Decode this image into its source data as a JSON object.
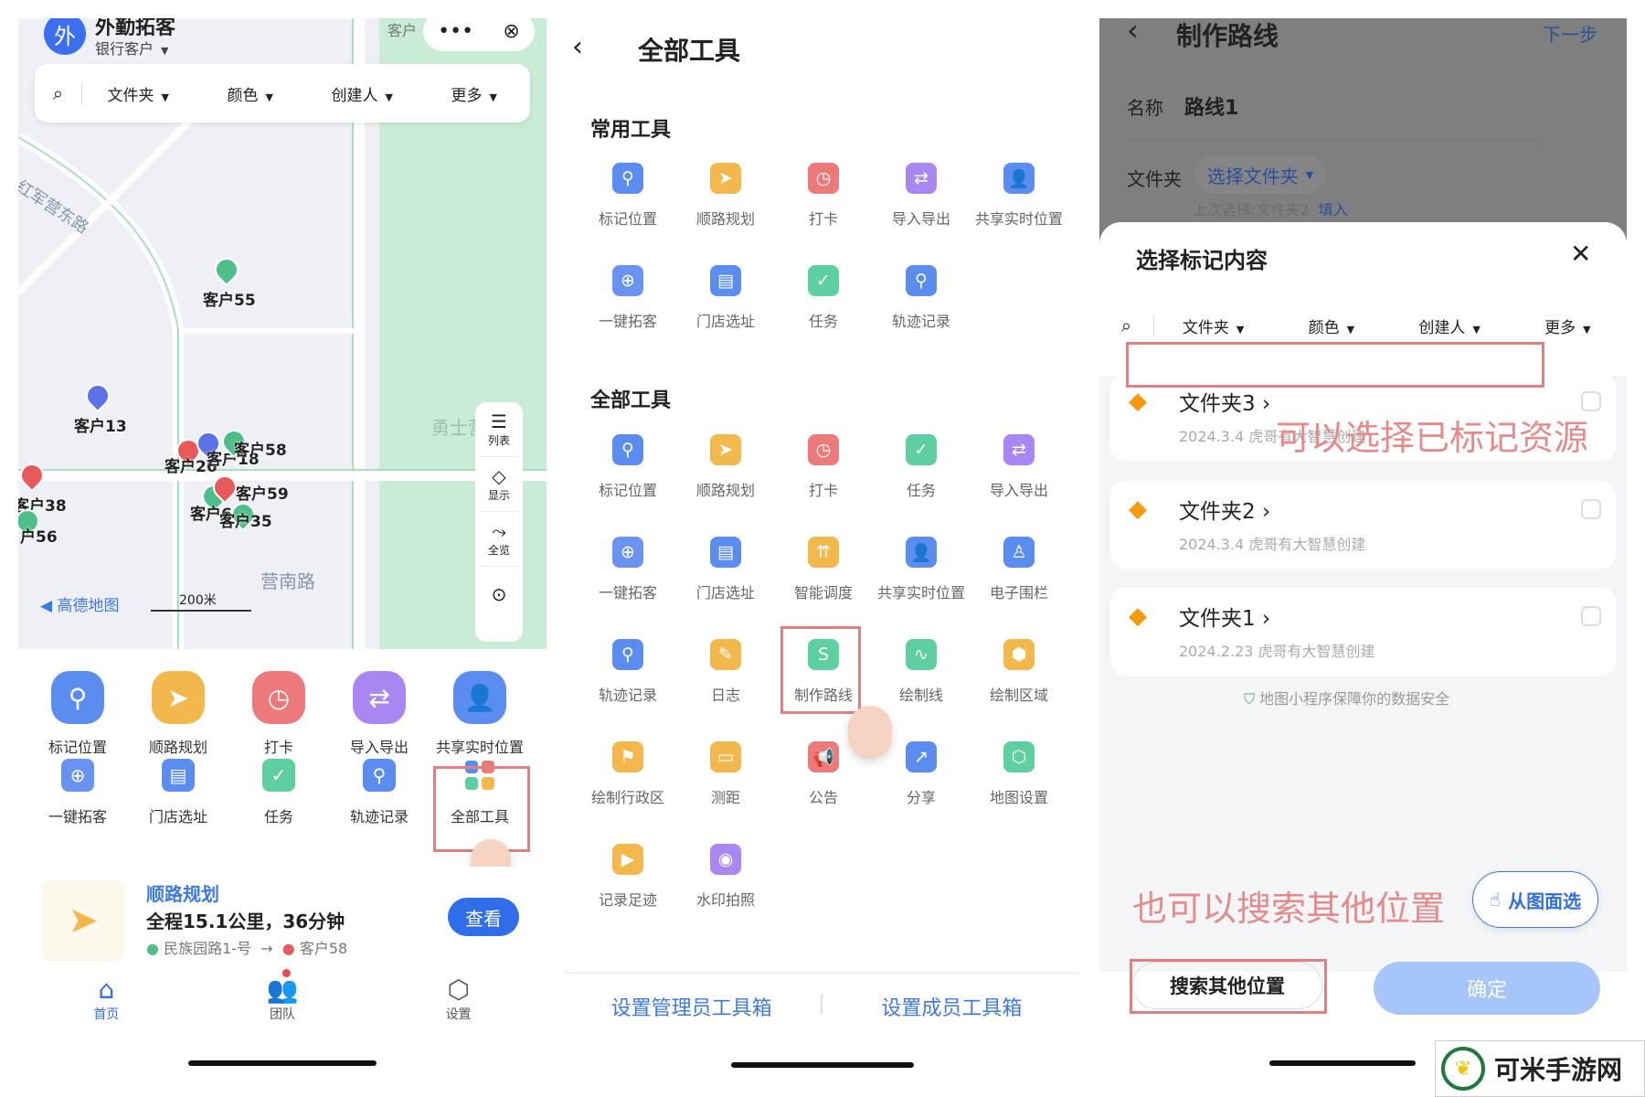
{
  "left": {
    "app": {
      "avatar": "外",
      "title": "外勤拓客",
      "subtitle": "银行客户",
      "map_top_label": "客户"
    },
    "filters": [
      "文件夹",
      "颜色",
      "创建人",
      "更多"
    ],
    "map": {
      "road_labels": [
        "红军营东路",
        "营南路",
        "勇士营部野"
      ],
      "brand": "高德地图",
      "scale": "200米",
      "pins": [
        {
          "label": "客户55",
          "color": "#4fbf8a"
        },
        {
          "label": "客户13",
          "color": "#5b72e8"
        },
        {
          "label": "客户38",
          "color": "#e85a5a"
        },
        {
          "label": "客户26",
          "color": "#e85a5a"
        },
        {
          "label": "客户18",
          "color": "#5b72e8"
        },
        {
          "label": "客户58",
          "color": "#4fbf8a"
        },
        {
          "label": "客户60",
          "color": "#4fbf8a"
        },
        {
          "label": "客户59",
          "color": "#e85a5a"
        },
        {
          "label": "客户35",
          "color": "#4fbf8a"
        },
        {
          "label": "户56",
          "color": "#4fbf8a"
        }
      ],
      "side_tools": [
        {
          "label": "列表",
          "icon": "list-icon"
        },
        {
          "label": "显示",
          "icon": "layers-icon"
        },
        {
          "label": "全览",
          "icon": "overview-icon"
        }
      ]
    },
    "tools_row1": [
      {
        "label": "标记位置",
        "color": "#5b8cf0",
        "glyph": "⚲"
      },
      {
        "label": "顺路规划",
        "color": "#f2b84b",
        "glyph": "➤"
      },
      {
        "label": "打卡",
        "color": "#ec7a7a",
        "glyph": "◷"
      },
      {
        "label": "导入导出",
        "color": "#a887f2",
        "glyph": "⇄"
      },
      {
        "label": "共享实时位置",
        "color": "#5b8cf0",
        "glyph": "👤"
      }
    ],
    "tools_row2": [
      {
        "label": "一键拓客",
        "color": "#6a92f0",
        "glyph": "⊕"
      },
      {
        "label": "门店选址",
        "color": "#5b8cf0",
        "glyph": "▤"
      },
      {
        "label": "任务",
        "color": "#5ecfa0",
        "glyph": "✓"
      },
      {
        "label": "轨迹记录",
        "color": "#5b8cf0",
        "glyph": "⚲"
      },
      {
        "label": "全部工具",
        "color": "#ffffff",
        "glyph": "▦"
      }
    ],
    "route": {
      "title": "顺路规划",
      "summary": "全程15.1公里，36分钟",
      "from": "民族园路1-号",
      "to": "客户58",
      "button": "查看"
    },
    "tabs": [
      {
        "label": "首页",
        "icon": "home-icon",
        "active": true
      },
      {
        "label": "团队",
        "icon": "team-icon"
      },
      {
        "label": "设置",
        "icon": "settings-icon"
      }
    ]
  },
  "middle": {
    "title": "全部工具",
    "common_title": "常用工具",
    "all_title": "全部工具",
    "common": [
      {
        "label": "标记位置",
        "color": "#5b8cf0",
        "glyph": "⚲"
      },
      {
        "label": "顺路规划",
        "color": "#f2b84b",
        "glyph": "➤"
      },
      {
        "label": "打卡",
        "color": "#ec7a7a",
        "glyph": "◷"
      },
      {
        "label": "导入导出",
        "color": "#a887f2",
        "glyph": "⇄"
      },
      {
        "label": "共享实时位置",
        "color": "#5b8cf0",
        "glyph": "👤"
      },
      {
        "label": "一键拓客",
        "color": "#6a92f0",
        "glyph": "⊕"
      },
      {
        "label": "门店选址",
        "color": "#5b8cf0",
        "glyph": "▤"
      },
      {
        "label": "任务",
        "color": "#5ecfa0",
        "glyph": "✓"
      },
      {
        "label": "轨迹记录",
        "color": "#5b8cf0",
        "glyph": "⚲"
      }
    ],
    "all": [
      {
        "label": "标记位置",
        "color": "#5b8cf0",
        "glyph": "⚲"
      },
      {
        "label": "顺路规划",
        "color": "#f2b84b",
        "glyph": "➤"
      },
      {
        "label": "打卡",
        "color": "#ec7a7a",
        "glyph": "◷"
      },
      {
        "label": "任务",
        "color": "#5ecfa0",
        "glyph": "✓"
      },
      {
        "label": "导入导出",
        "color": "#a887f2",
        "glyph": "⇄"
      },
      {
        "label": "一键拓客",
        "color": "#6a92f0",
        "glyph": "⊕"
      },
      {
        "label": "门店选址",
        "color": "#5b8cf0",
        "glyph": "▤"
      },
      {
        "label": "智能调度",
        "color": "#f2b84b",
        "glyph": "⇈"
      },
      {
        "label": "共享实时位置",
        "color": "#5b8cf0",
        "glyph": "👤"
      },
      {
        "label": "电子围栏",
        "color": "#5b8cf0",
        "glyph": "♙"
      },
      {
        "label": "轨迹记录",
        "color": "#5b8cf0",
        "glyph": "⚲"
      },
      {
        "label": "日志",
        "color": "#f2b84b",
        "glyph": "✎"
      },
      {
        "label": "制作路线",
        "color": "#5ecfa0",
        "glyph": "S"
      },
      {
        "label": "绘制线",
        "color": "#5ecfa0",
        "glyph": "∿"
      },
      {
        "label": "绘制区域",
        "color": "#f2b84b",
        "glyph": "⬢"
      },
      {
        "label": "绘制行政区",
        "color": "#f2b84b",
        "glyph": "⚑"
      },
      {
        "label": "测距",
        "color": "#f2b84b",
        "glyph": "▭"
      },
      {
        "label": "公告",
        "color": "#ec7a7a",
        "glyph": "📢"
      },
      {
        "label": "分享",
        "color": "#5b8cf0",
        "glyph": "↗"
      },
      {
        "label": "地图设置",
        "color": "#5ecfa0",
        "glyph": "⬡"
      },
      {
        "label": "记录足迹",
        "color": "#f2b84b",
        "glyph": "▶"
      },
      {
        "label": "水印拍照",
        "color": "#a887f2",
        "glyph": "◉"
      }
    ],
    "admin_link": "设置管理员工具箱",
    "member_link": "设置成员工具箱"
  },
  "right": {
    "title": "制作路线",
    "next": "下一步",
    "name_label": "名称",
    "name_value": "路线1",
    "folder_label": "文件夹",
    "folder_select": "选择文件夹",
    "last_choice": "上次选择:文件夹2",
    "fill": "填入",
    "sheet_title": "选择标记内容",
    "filters": [
      "文件夹",
      "颜色",
      "创建人",
      "更多"
    ],
    "folders": [
      {
        "name": "文件夹3",
        "meta": "2024.3.4 虎哥有大智慧创建"
      },
      {
        "name": "文件夹2",
        "meta": "2024.3.4 虎哥有大智慧创建"
      },
      {
        "name": "文件夹1",
        "meta": "2024.2.23 虎哥有大智慧创建"
      }
    ],
    "security": "地图小程序保障你的数据安全",
    "annotation1": "可以选择已标记资源",
    "annotation2": "也可以搜索其他位置",
    "map_select": "从图面选",
    "search_other": "搜索其他位置",
    "confirm": "确定"
  },
  "watermark": "可米手游网",
  "colors": {
    "accent": "#3b78e8",
    "highlight": "#e08080",
    "folder": "#f59a0a"
  }
}
